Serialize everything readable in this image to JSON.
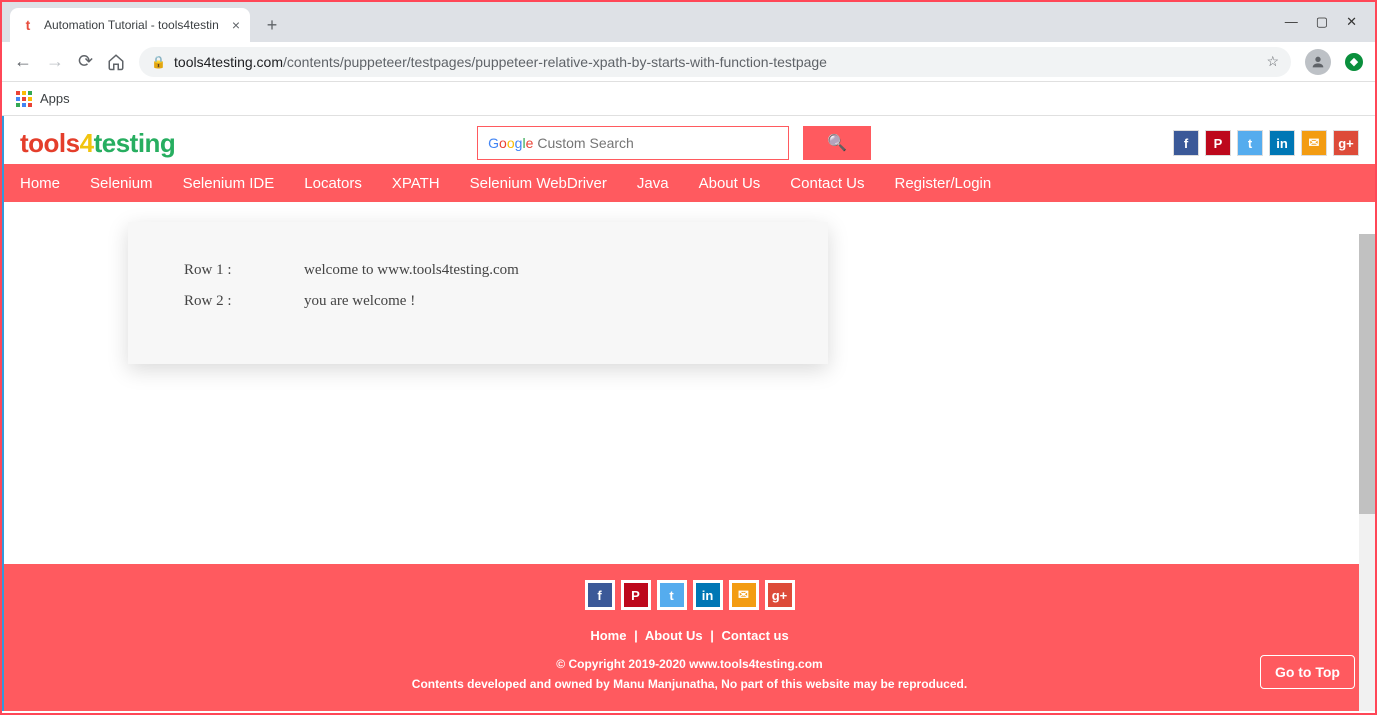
{
  "browser": {
    "tab_title": "Automation Tutorial - tools4testin",
    "url_domain": "tools4testing.com",
    "url_path": "/contents/puppeteer/testpages/puppeteer-relative-xpath-by-starts-with-function-testpage",
    "apps_label": "Apps"
  },
  "logo": {
    "part1": "tools",
    "bolt": "4",
    "part2": "testing"
  },
  "search": {
    "google_label": "Google",
    "placeholder": "Custom Search"
  },
  "nav": [
    "Home",
    "Selenium",
    "Selenium IDE",
    "Locators",
    "XPATH",
    "Selenium WebDriver",
    "Java",
    "About Us",
    "Contact Us",
    "Register/Login"
  ],
  "rows": [
    {
      "label": "Row 1 :",
      "value": "welcome to www.tools4testing.com"
    },
    {
      "label": "Row 2 :",
      "value": "you are welcome !"
    }
  ],
  "footer": {
    "links": [
      "Home",
      "About Us",
      "Contact us"
    ],
    "copyright": "© Copyright 2019-2020 www.tools4testing.com",
    "disclaimer": "Contents developed and owned by Manu Manjunatha, No part of this website may be reproduced.",
    "go_top": "Go to Top"
  },
  "social": {
    "facebook": "f",
    "pinterest": "P",
    "twitter": "t",
    "linkedin": "in",
    "mail": "✉",
    "gplus": "g+"
  }
}
